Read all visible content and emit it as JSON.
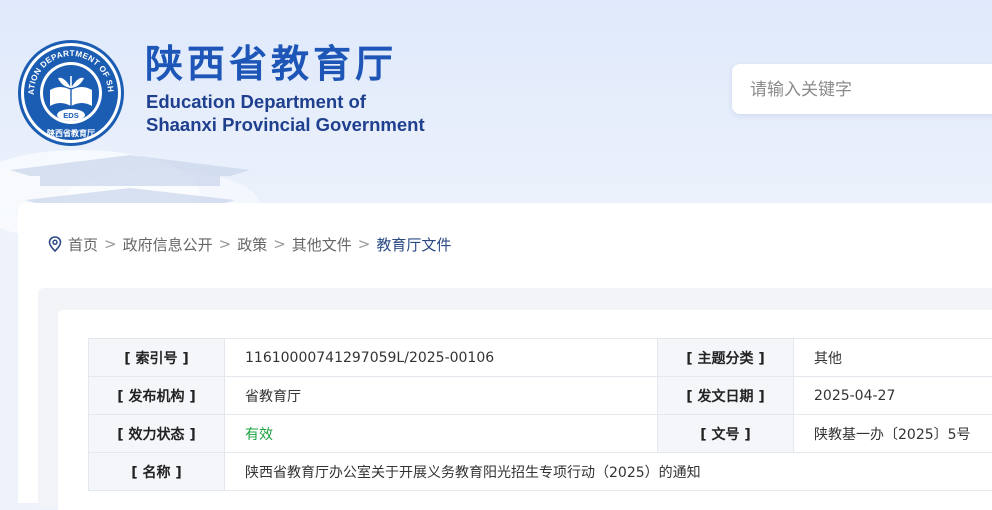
{
  "header": {
    "title_cn": "陕西省教育厅",
    "title_en_line1": "Education Department of",
    "title_en_line2": "Shaanxi Provincial Government",
    "logo_ring_text": "EDUCATION DEPARTMENT OF SHAANXI",
    "logo_center_text": "EDS",
    "logo_bottom_text": "陕西省教育厅"
  },
  "search": {
    "placeholder": "请输入关键字"
  },
  "breadcrumb": {
    "items": [
      "首页",
      "政府信息公开",
      "政策",
      "其他文件",
      "教育厅文件"
    ],
    "separator": ">"
  },
  "meta": {
    "index_no_label": "[ 索引号 ]",
    "index_no": "11610000741297059L/2025-00106",
    "topic_label": "[ 主题分类 ]",
    "topic": "其他",
    "publisher_label": "[ 发布机构 ]",
    "publisher": "省教育厅",
    "date_label": "[ 发文日期 ]",
    "date": "2025-04-27",
    "status_label": "[ 效力状态 ]",
    "status": "有效",
    "doc_no_label": "[ 文号 ]",
    "doc_no": "陕教基一办〔2025〕5号",
    "name_label": "[ 名称 ]",
    "name": "陕西省教育厅办公室关于开展义务教育阳光招生专项行动（2025）的通知"
  },
  "colors": {
    "brand_blue": "#1d56b7",
    "status_green": "#19a33e"
  }
}
